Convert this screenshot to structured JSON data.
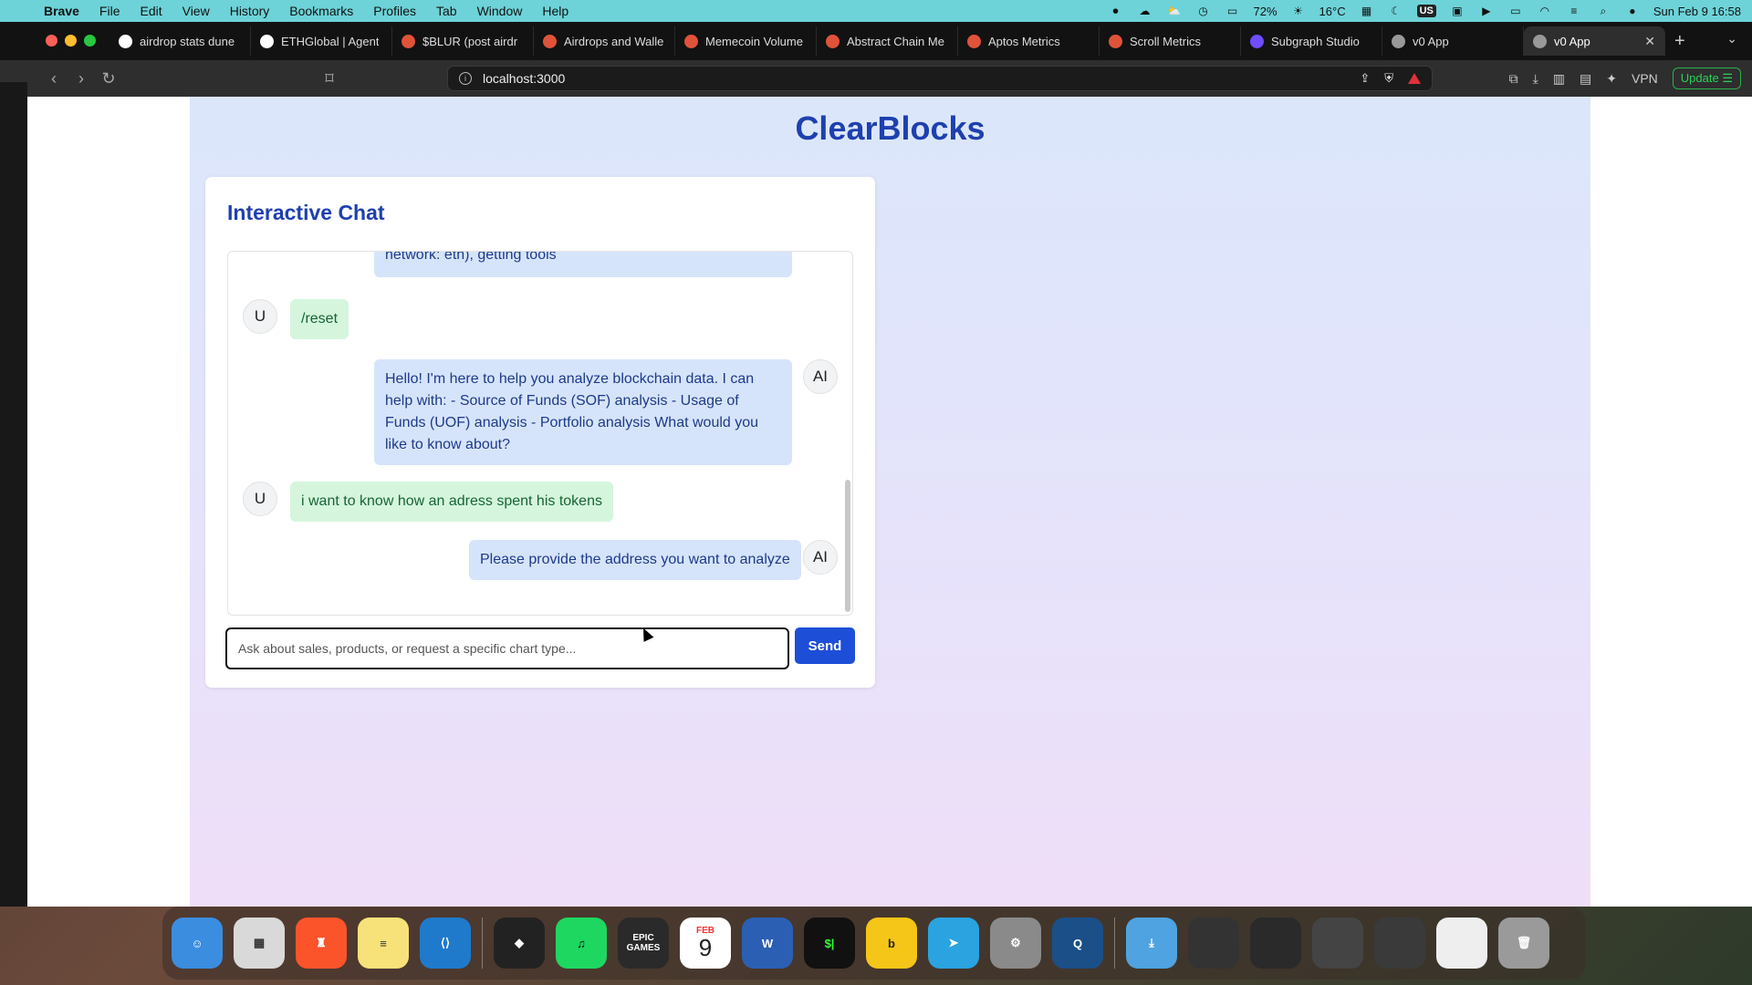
{
  "menubar": {
    "app_name": "Brave",
    "items": [
      "File",
      "Edit",
      "View",
      "History",
      "Bookmarks",
      "Profiles",
      "Tab",
      "Window",
      "Help"
    ],
    "battery": "72%",
    "weather": "16°C",
    "input_source": "US",
    "datetime": "Sun Feb 9  16:58"
  },
  "tabs": [
    {
      "label": "airdrop stats dune",
      "color": "#ffffff",
      "active": false
    },
    {
      "label": "ETHGlobal | Agent",
      "color": "#ffffff",
      "active": false
    },
    {
      "label": "$BLUR (post airdr",
      "color": "#e0533a",
      "active": false
    },
    {
      "label": "Airdrops and Walle",
      "color": "#e0533a",
      "active": false
    },
    {
      "label": "Memecoin Volume",
      "color": "#e0533a",
      "active": false
    },
    {
      "label": "Abstract Chain Me",
      "color": "#e0533a",
      "active": false
    },
    {
      "label": "Aptos Metrics",
      "color": "#e0533a",
      "active": false
    },
    {
      "label": "Scroll Metrics",
      "color": "#e0533a",
      "active": false
    },
    {
      "label": "Subgraph Studio",
      "color": "#6f4cff",
      "active": false
    },
    {
      "label": "v0 App",
      "color": "#999999",
      "active": false
    },
    {
      "label": "v0 App",
      "color": "#999999",
      "active": true
    }
  ],
  "toolbar": {
    "url": "localhost:3000",
    "vpn": "VPN",
    "update": "Update"
  },
  "page": {
    "title": "ClearBlocks",
    "chat": {
      "title": "Interactive Chat",
      "partial_text": "network: eth), getting tools",
      "messages": [
        {
          "role": "user",
          "avatar": "U",
          "text": "/reset"
        },
        {
          "role": "ai",
          "avatar": "AI",
          "text": "Hello! I'm here to help you analyze blockchain data. I can help with: - Source of Funds (SOF) analysis - Usage of Funds (UOF) analysis - Portfolio analysis What would you like to know about?"
        },
        {
          "role": "user",
          "avatar": "U",
          "text": "i want to know how an adress spent his tokens"
        },
        {
          "role": "ai",
          "avatar": "AI",
          "text": "Please provide the address you want to analyze"
        }
      ],
      "input_placeholder": "Ask about sales, products, or request a specific chart type...",
      "send_label": "Send"
    }
  },
  "dock": {
    "apps": [
      "Finder",
      "Launchpad",
      "Brave",
      "Notes",
      "VS Code",
      "Unity",
      "Spotify",
      "Epic Games",
      "Calendar",
      "Word",
      "Terminal",
      "Bumble",
      "Telegram",
      "System Settings",
      "QuickTime",
      "Downloads",
      "Window",
      "Window",
      "Window",
      "Window",
      "Window",
      "Trash"
    ],
    "calendar_month": "FEB",
    "calendar_day": "9",
    "epic_label": "EPIC GAMES"
  }
}
